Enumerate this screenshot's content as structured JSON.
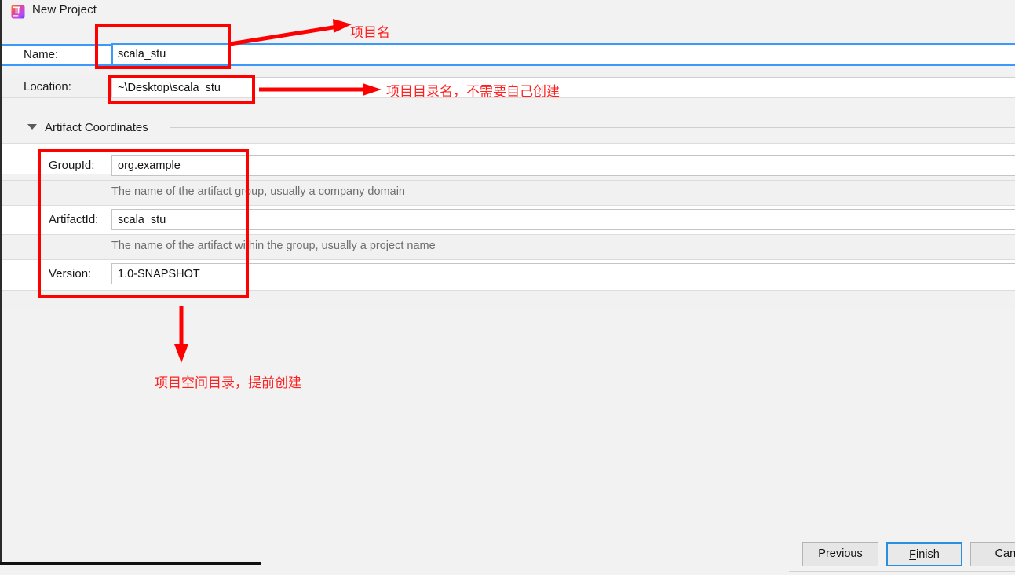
{
  "window": {
    "title": "New Project",
    "icon": "intellij-idea-logo-icon"
  },
  "form": {
    "name": {
      "label": "Name:",
      "value": "scala_stu",
      "focused": true
    },
    "location": {
      "label": "Location:",
      "value": "~\\Desktop\\scala_stu"
    }
  },
  "section": {
    "title": "Artifact Coordinates",
    "expanded": true,
    "fields": [
      {
        "label": "GroupId:",
        "value": "org.example",
        "help": "The name of the artifact group, usually a company domain"
      },
      {
        "label": "ArtifactId:",
        "value": "scala_stu",
        "help": "The name of the artifact within the group, usually a project name"
      },
      {
        "label": "Version:",
        "value": "1.0-SNAPSHOT",
        "help": ""
      }
    ]
  },
  "annotations": {
    "color": "#fe0000",
    "name_note": "项目名",
    "location_note": "项目目录名，不需要自己创建",
    "coordinates_note": "项目空间目录，提前创建"
  },
  "footer": {
    "previous": "Previous",
    "previous_mnemonic": "P",
    "previous_rest": "revious",
    "finish": "Finish",
    "finish_mnemonic": "F",
    "finish_rest": "inish",
    "cancel": "Canc"
  }
}
